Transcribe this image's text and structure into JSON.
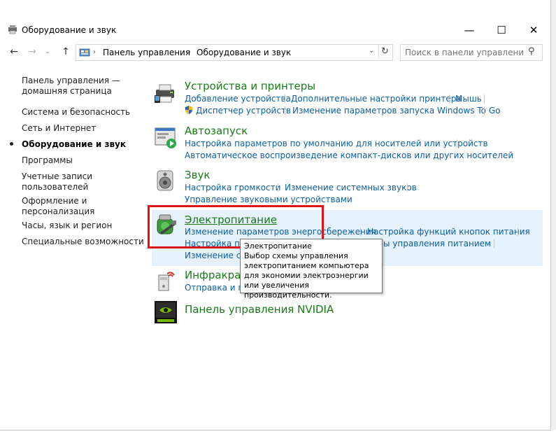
{
  "window": {
    "title": "Оборудование и звук",
    "controls": {
      "minimize": "—",
      "maximize": "☐",
      "close": "✕"
    }
  },
  "address": {
    "crumbs": [
      "Панель управления",
      "Оборудование и звук"
    ],
    "search_placeholder": "Поиск в панели управления"
  },
  "sidebar": {
    "items": [
      {
        "label": "Панель управления —\nдомашняя страница",
        "active": false
      },
      {
        "label": "Система и безопасность",
        "active": false
      },
      {
        "label": "Сеть и Интернет",
        "active": false
      },
      {
        "label": "Оборудование и звук",
        "active": true
      },
      {
        "label": "Программы",
        "active": false
      },
      {
        "label": "Учетные записи\nпользователей",
        "active": false
      },
      {
        "label": "Оформление и\nперсонализация",
        "active": false
      },
      {
        "label": "Часы, язык и регион",
        "active": false
      },
      {
        "label": "Специальные возможности",
        "active": false
      }
    ]
  },
  "categories": [
    {
      "title": "Устройства и принтеры",
      "icon": "printer-icon",
      "links": [
        "Добавление устройства",
        "Дополнительные настройки принтера",
        "Мышь",
        "Диспетчер устройств",
        "Изменение параметров запуска Windows To Go"
      ]
    },
    {
      "title": "Автозапуск",
      "icon": "autoplay-icon",
      "links": [
        "Настройка параметров по умолчанию для носителей или устройств",
        "Автоматическое воспроизведение компакт-дисков или других носителей"
      ]
    },
    {
      "title": "Звук",
      "icon": "speaker-icon",
      "links": [
        "Настройка громкости",
        "Изменение системных звуков",
        "Управление звуковыми устройствами"
      ]
    },
    {
      "title": "Электропитание",
      "icon": "power-options-icon",
      "links": [
        "Изменение параметров энергосбережения",
        "Настройка функций кнопок питания",
        "Настройка пе",
        "ы управления питанием",
        "Изменение схе"
      ]
    },
    {
      "title": "Инфракрас",
      "icon": "infrared-icon",
      "links": [
        "Отправка и по"
      ]
    },
    {
      "title": "Панель управления NVIDIA",
      "icon": "nvidia-icon",
      "links": []
    }
  ],
  "tooltip": {
    "title": "Электропитание",
    "text": "Выбор схемы управления электропитанием компьютера для экономии электроэнергии или увеличения производительности."
  },
  "colors": {
    "category_title": "#1a7a1a",
    "link": "#0b5fa5",
    "highlight": "#e5f2fb",
    "annotation_box": "#e01414"
  }
}
